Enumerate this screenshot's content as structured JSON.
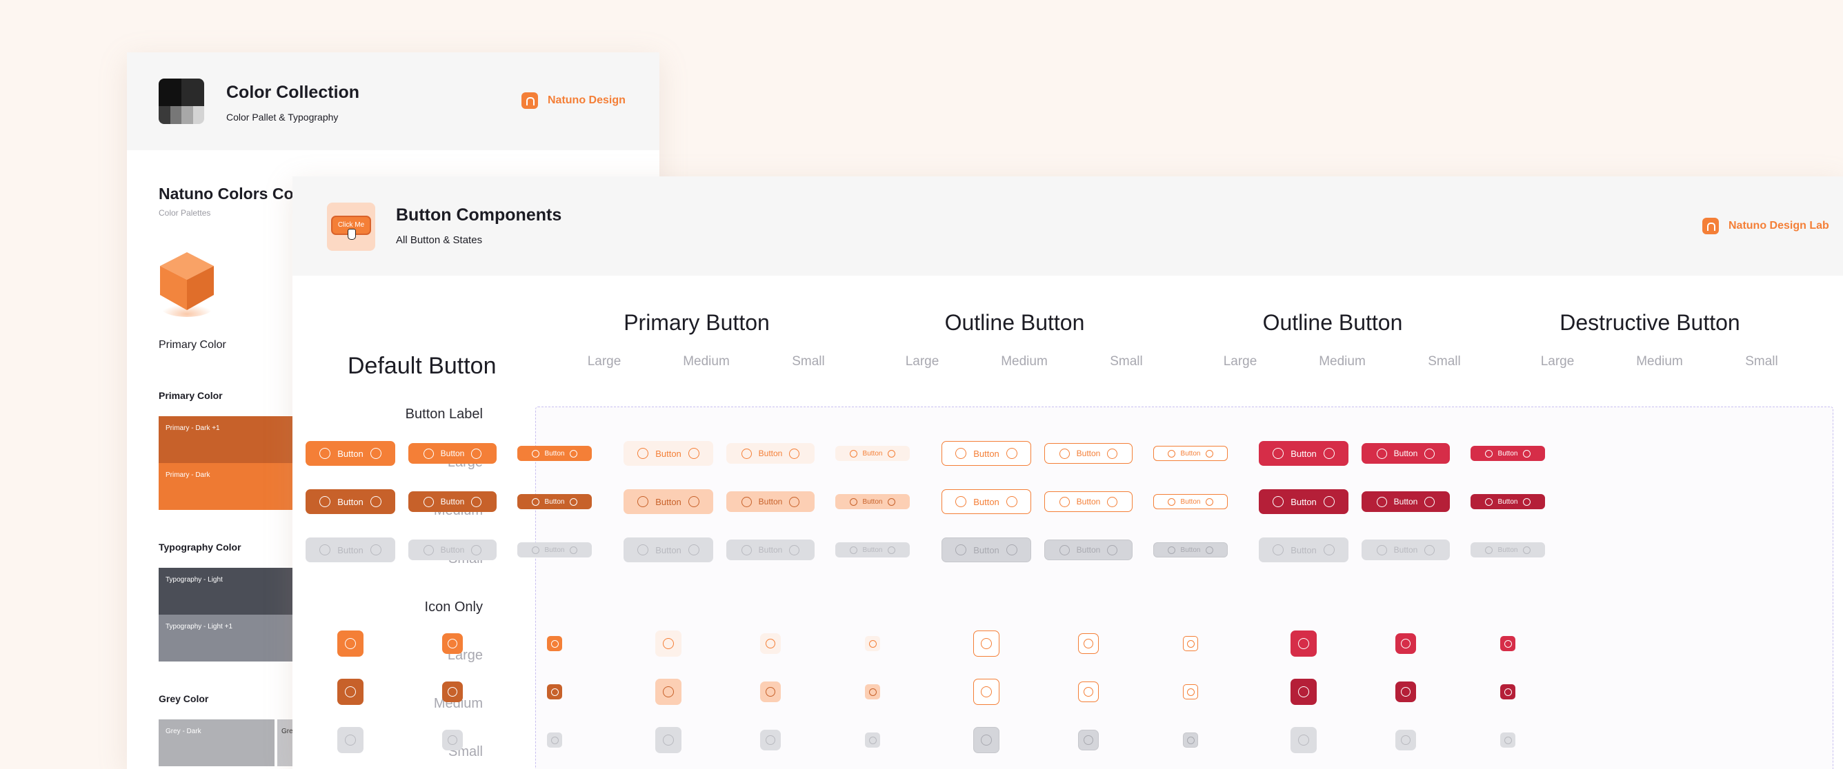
{
  "colors": {
    "primary": "#f47f37",
    "primary_dark": "#c7612a",
    "primary_disabled": "#dcdde1",
    "outline_light_bg": "#fde7da",
    "outline_pressed_bg": "#fccfb4",
    "destructive": "#d62d48",
    "destructive_dark": "#b51f38",
    "typography_light": "#4b4e57",
    "typography_light_plus": "#878a93",
    "grey_dark": "#b0b1b5"
  },
  "back_card": {
    "title": "Color Collection",
    "subtitle": "Color Pallet & Typography",
    "brand": "Natuno Design",
    "section_title": "Natuno Colors Collection",
    "section_subtitle": "Color Palettes",
    "primary_color_caption": "Primary Color",
    "primary_color_heading": "Primary Color",
    "primary_swatches": [
      "Primary - Dark +1",
      "Primary - Dark"
    ],
    "typography_heading": "Typography Color",
    "typography_swatches": [
      "Typography - Light",
      "Typography - Light +1"
    ],
    "grey_heading": "Grey Color",
    "grey_swatches": [
      "Grey - Dark",
      "Gre"
    ]
  },
  "front_card": {
    "icon_button_label": "Click Me",
    "title": "Button Components",
    "subtitle": "All Button & States",
    "brand": "Natuno Design Lab",
    "default_title": "Default Button",
    "row_labels": [
      "Button Label",
      "Large",
      "Medium",
      "Small",
      "Icon Only",
      "Large",
      "Medium",
      "Small"
    ],
    "groups": [
      {
        "title": "Primary Button",
        "sizes": [
          "Large",
          "Medium",
          "Small"
        ]
      },
      {
        "title": "Outline Button",
        "sizes": [
          "Large",
          "Medium",
          "Small"
        ]
      },
      {
        "title": "Outline Button",
        "sizes": [
          "Large",
          "Medium",
          "Small"
        ]
      },
      {
        "title": "Destructive Button",
        "sizes": [
          "Large",
          "Medium",
          "Small"
        ]
      }
    ],
    "button_text": "Button"
  }
}
